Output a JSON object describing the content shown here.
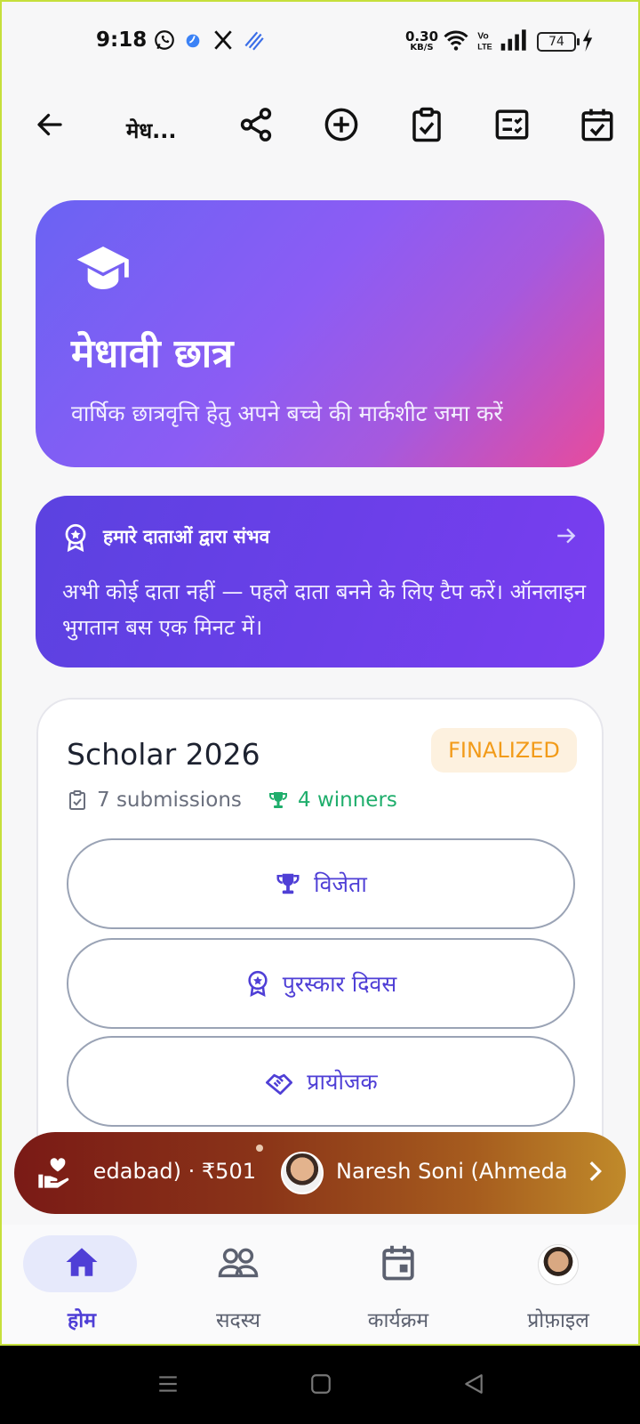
{
  "status_bar": {
    "time": "9:18",
    "net_speed_value": "0.30",
    "net_speed_unit": "KB/S",
    "battery": "74"
  },
  "app_bar": {
    "title": "मेध...",
    "icons": [
      "back-arrow-icon",
      "share-icon",
      "add-circle-icon",
      "clipboard-check-icon",
      "checklist-icon",
      "calendar-check-icon"
    ]
  },
  "hero": {
    "title": "मेधावी छात्र",
    "subtitle": "वार्षिक छात्रवृत्ति हेतु अपने बच्चे की मार्कशीट जमा करें",
    "icon": "graduation-cap-icon"
  },
  "donors": {
    "title": "हमारे दाताओं द्वारा संभव",
    "body": "अभी कोई दाता नहीं — पहले दाता बनने के लिए टैप करें। ऑनलाइन भुगतान बस एक मिनट में।"
  },
  "scholar_card": {
    "title": "Scholar 2026",
    "status": "FINALIZED",
    "submissions": "7 submissions",
    "winners": "4 winners",
    "buttons": [
      {
        "label": "विजेता",
        "icon": "trophy-icon"
      },
      {
        "label": "पुरस्कार दिवस",
        "icon": "award-ribbon-icon"
      },
      {
        "label": "प्रायोजक",
        "icon": "handshake-icon"
      }
    ]
  },
  "ticker": {
    "text1": "edabad) · ₹501",
    "text2": "Naresh Soni (Ahmeda"
  },
  "bottom_nav": {
    "items": [
      {
        "label": "होम",
        "icon": "home-icon",
        "active": true
      },
      {
        "label": "सदस्य",
        "icon": "members-icon",
        "active": false
      },
      {
        "label": "कार्यक्रम",
        "icon": "calendar-icon",
        "active": false
      },
      {
        "label": "प्रोफ़ाइल",
        "icon": "profile-avatar",
        "active": false
      }
    ]
  },
  "colors": {
    "accent": "#4f3fd6",
    "finalized_text": "#f29b19",
    "winners_green": "#1fae6c"
  }
}
